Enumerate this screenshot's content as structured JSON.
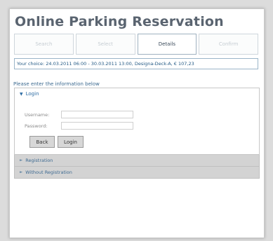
{
  "app": {
    "title": "Online Parking Reservation"
  },
  "steps": [
    {
      "label": "Search",
      "active": false
    },
    {
      "label": "Select",
      "active": false
    },
    {
      "label": "Details",
      "active": true
    },
    {
      "label": "Confirm",
      "active": false
    }
  ],
  "choice": {
    "text": "Your choice: 24.03.2011 06:00 - 30.03.2011 13:00, Designa-Deck-A, € 107,23"
  },
  "form": {
    "instruction": "Please enter the information below",
    "login_section": {
      "label": "Login",
      "username_label": "Username:",
      "username_value": "",
      "password_label": "Password:",
      "password_value": "",
      "back_label": "Back",
      "login_label": "Login"
    },
    "registration_section": {
      "label": "Registration"
    },
    "without_registration_section": {
      "label": "Without Registration"
    }
  }
}
